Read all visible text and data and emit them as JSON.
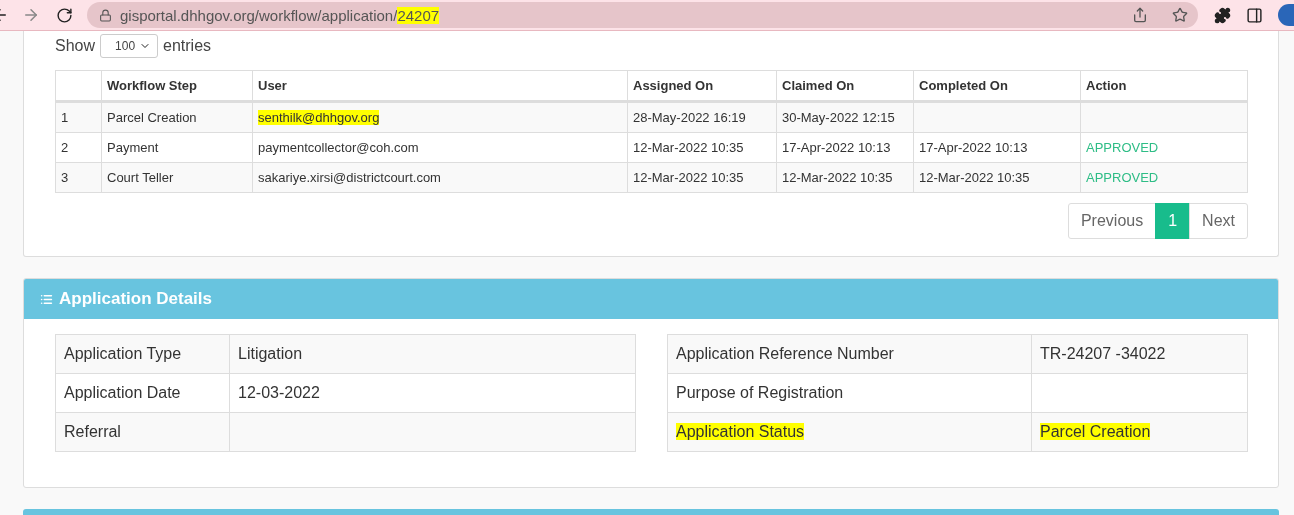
{
  "browser": {
    "url_parts": [
      {
        "text": "gisportal.dhhgov.org/workflow/application/",
        "highlighted": false
      },
      {
        "text": "24207",
        "highlighted": true
      }
    ]
  },
  "workflow": {
    "show_label": "Show",
    "page_size": "100",
    "entries_label": "entries",
    "columns": [
      "",
      "Workflow Step",
      "User",
      "Assigned On",
      "Claimed On",
      "Completed On",
      "Action"
    ],
    "rows": [
      {
        "no": "1",
        "step": "Parcel Creation",
        "user": {
          "text": "senthilk@dhhgov.org",
          "highlighted": true
        },
        "assigned_on": "28-May-2022 16:19",
        "claimed_on": "30-May-2022 12:15"
      },
      {
        "no": "2",
        "step": "Payment",
        "user": {
          "text": "paymentcollector@coh.com",
          "highlighted": false
        },
        "assigned_on": "12-Mar-2022 10:35",
        "claimed_on": "17-Apr-2022 10:13",
        "completed_on": "17-Apr-2022 10:13",
        "action": "APPROVED"
      },
      {
        "no": "3",
        "step": "Court Teller",
        "user": {
          "text": "sakariye.xirsi@districtcourt.com",
          "highlighted": false
        },
        "assigned_on": "12-Mar-2022 10:35",
        "claimed_on": "12-Mar-2022 10:35",
        "completed_on": "12-Mar-2022 10:35",
        "action": "APPROVED"
      }
    ],
    "pagination": [
      {
        "label": "Previous",
        "selected": false
      },
      {
        "label": "1",
        "selected": true
      },
      {
        "label": "Next",
        "selected": false
      }
    ]
  },
  "application_details": {
    "title": "Application Details",
    "left": [
      {
        "label": "Application Type",
        "value": "Litigation",
        "highlighted": false
      },
      {
        "label": "Application Date",
        "value": "12-03-2022",
        "highlighted": false
      },
      {
        "label": "Referral",
        "highlighted": false
      }
    ],
    "right": [
      {
        "label": "Application Reference Number",
        "value": "TR-24207 -34022",
        "highlighted": false
      },
      {
        "label": "Purpose of Registration",
        "highlighted": false
      },
      {
        "label": "Application Status",
        "value": "Parcel Creation",
        "highlighted": true
      }
    ]
  }
}
